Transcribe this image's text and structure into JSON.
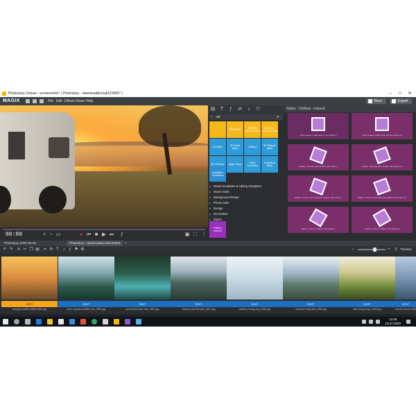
{
  "window": {
    "title": "Photostory Deluxe - screenshots* ( Photostory - download&cmall123505* )",
    "controls": [
      "–",
      "□",
      "✕"
    ]
  },
  "menubar": {
    "logo": "MAGIX",
    "menus": [
      "File",
      "Edit",
      "Effects",
      "Share",
      "Help"
    ],
    "burn_label": "Burn",
    "export_label": "Export"
  },
  "preview": {
    "timecode": "00:00"
  },
  "media_panel": {
    "filter_value": "all",
    "tiles": [
      "",
      "PREMIUM",
      "STRIPE COLLECTION",
      "MYSTIC COLLECTION",
      "3D Slider",
      "3D Swirls Basic",
      "Chillout",
      "3D Shapes Basic",
      "3D Tilt Basic",
      "Magic Basic",
      "Effect Transition",
      "Transitions Basic",
      "Inspiration Transitions"
    ],
    "categories": [
      "Movie templates & editing templates",
      "Movie looks",
      "Background design",
      "Photo looks",
      "Design",
      "Decoration",
      "Styles"
    ],
    "style_tile": "Chillout relaxed"
  },
  "styles_panel": {
    "header": "Styles - Chillout - relaxed",
    "thumbs": [
      "Pink Images: subtle fade in and scale in",
      "Light Images: subtle slide out and scale out",
      "Subtle: curiously and rotation with scale in",
      "Subtle: curiously and rotation with scale out",
      "Subtle: curious: horizontal and rotation with scale in",
      "Subtle: curious: horizontal and rotation with scale out",
      "Subtle: curious: rotation with scale in",
      "Subtle: curious: rotation with scale out"
    ]
  },
  "tabs": [
    {
      "label": "Photostory 2020-06-29"
    },
    {
      "label": "Photostory - download&cmall123505"
    }
  ],
  "toolbar2": {
    "timeline_label": "Timeline"
  },
  "clips": [
    {
      "duration": "00:07",
      "name": "camping-vanlike-wildlife-AR81.jpg"
    },
    {
      "duration": "00:07",
      "name": "pearl-olympia-outfitted-view_AR81.jpg"
    },
    {
      "duration": "00:07",
      "name": "government-lake-view_AR81.jpg"
    },
    {
      "duration": "00:07",
      "name": "vansun-yosemite-park_AR81.jpg"
    },
    {
      "duration": "00:07",
      "name": "sealake-rushing-day_AR81.jpg"
    },
    {
      "duration": "00:07",
      "name": "mountain-rising-lake_AR81.jpg"
    },
    {
      "duration": "00:07",
      "name": "silver-living-slope_AR81.jpg"
    },
    {
      "duration": "00:07",
      "name": "clouded-cloud_AR81.jpg"
    }
  ],
  "taskbar": {
    "time": "13:45",
    "date": "15.07.2020"
  }
}
